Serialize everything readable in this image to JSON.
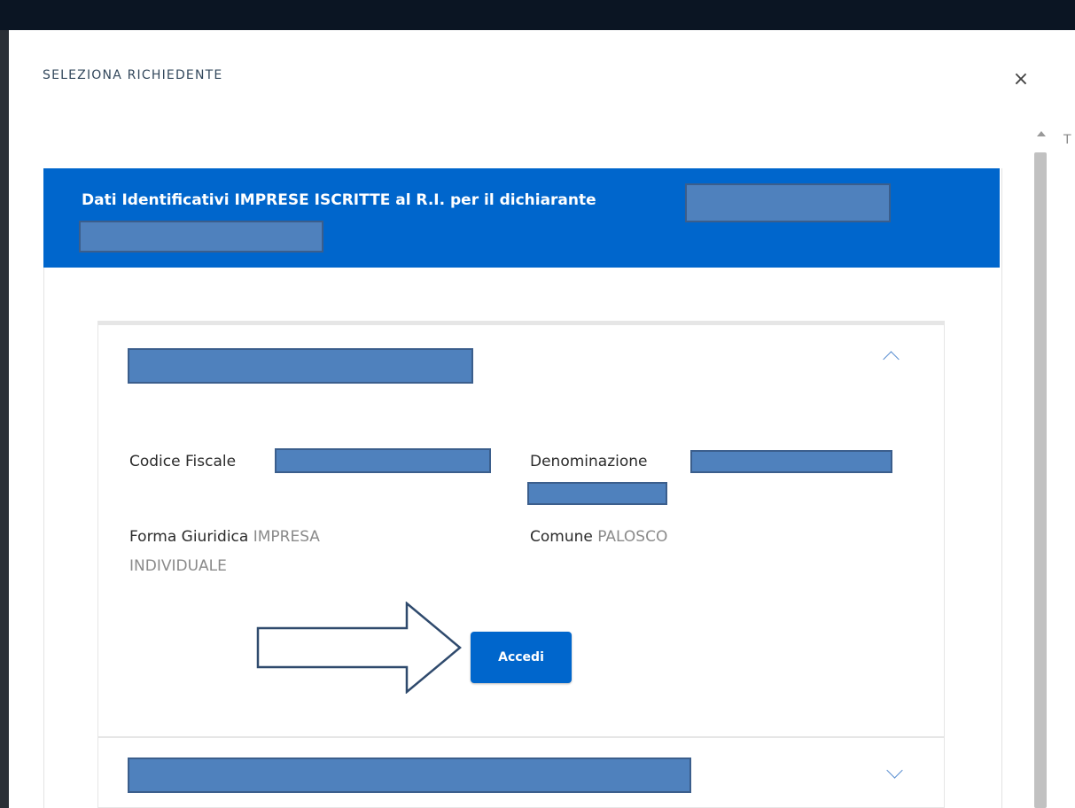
{
  "modal": {
    "title": "SELEZIONA RICHIEDENTE",
    "close_icon": "close-icon",
    "close_glyph": "×"
  },
  "header": {
    "text": "Dati Identificativi IMPRESE ISCRITTE al R.I. per il dichiarante"
  },
  "card": {
    "codice_fiscale_label": "Codice Fiscale",
    "denominazione_label": "Denominazione",
    "forma_giuridica_label": "Forma Giuridica",
    "forma_giuridica_value_1": "IMPRESA",
    "forma_giuridica_value_2": "INDIVIDUALE",
    "comune_label": "Comune",
    "comune_value": "PALOSCO",
    "button_label": "Accedi",
    "expand_icon": "chevron-up-icon"
  },
  "card2": {
    "expand_icon": "chevron-down-icon"
  },
  "background": {
    "partial_text": "T"
  },
  "colors": {
    "primary": "#0066cc",
    "redaction": "#4f81bd",
    "title": "#33485c"
  }
}
